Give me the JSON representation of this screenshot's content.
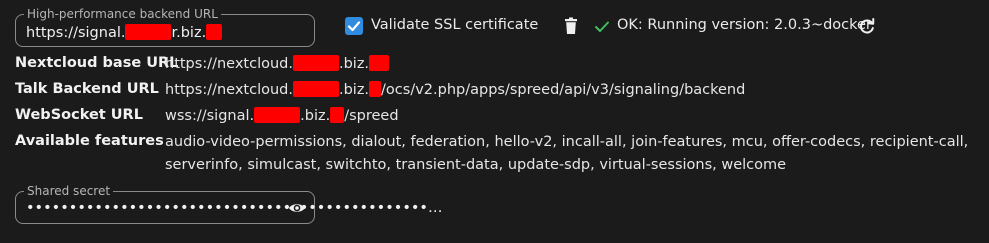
{
  "backend": {
    "legend": "High-performance backend URL",
    "value_prefix": "https://signal.",
    "value_mid": "r.biz.",
    "validate_label": "Validate SSL certificate",
    "status_text": "OK: Running version: 2.0.3~docker"
  },
  "info": {
    "nextcloud_key": "Nextcloud base URL",
    "nextcloud_prefix": "https://nextcloud.",
    "nextcloud_suffix": ".biz.",
    "talk_key": "Talk Backend URL",
    "talk_prefix": "https://nextcloud.",
    "talk_mid": ".biz.",
    "talk_suffix": "/ocs/v2.php/apps/spreed/api/v3/signaling/backend",
    "ws_key": "WebSocket URL",
    "ws_prefix": "wss://signal.",
    "ws_mid": ".biz.",
    "ws_suffix": "/spreed",
    "features_key": "Available features",
    "features_value": "audio-video-permissions, dialout, federation, hello-v2, incall-all, join-features, mcu, offer-codecs, recipient-call, serverinfo, simulcast, switchto, transient-data, update-sdp, virtual-sessions, welcome"
  },
  "secret": {
    "legend": "Shared secret",
    "masked_value": "•••••••••••••••••••••••••••••••••••••••••••••••…"
  },
  "icons": {
    "trash": "trash-icon",
    "check": "check-icon",
    "refresh": "refresh-icon",
    "eye": "eye-icon"
  },
  "colors": {
    "background": "#1b1b1b",
    "accent": "#2f8cde",
    "ok": "#3fbf5f",
    "redaction": "#ff0000"
  }
}
